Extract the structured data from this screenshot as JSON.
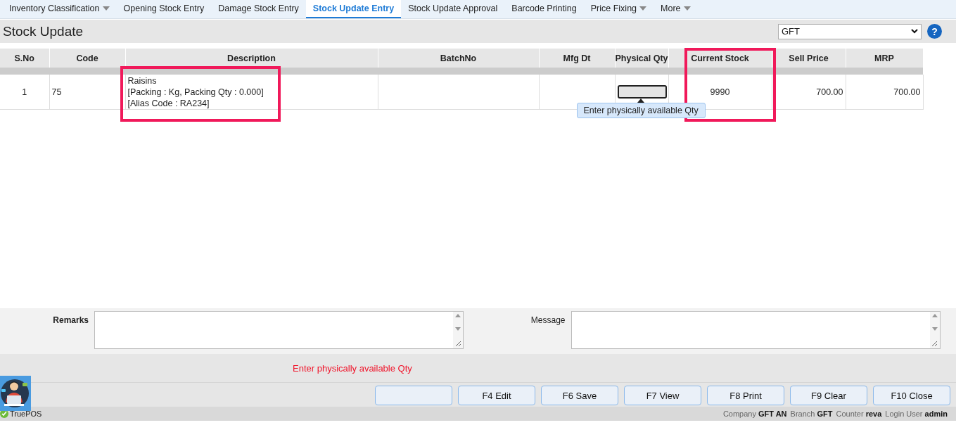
{
  "tabs": [
    {
      "label": "Inventory Classification",
      "has_menu": true,
      "selected": false
    },
    {
      "label": "Opening Stock Entry",
      "has_menu": false,
      "selected": false
    },
    {
      "label": "Damage Stock Entry",
      "has_menu": false,
      "selected": false
    },
    {
      "label": "Stock Update Entry",
      "has_menu": false,
      "selected": true
    },
    {
      "label": "Stock Update Approval",
      "has_menu": false,
      "selected": false
    },
    {
      "label": "Barcode Printing",
      "has_menu": false,
      "selected": false
    },
    {
      "label": "Price Fixing",
      "has_menu": true,
      "selected": false
    },
    {
      "label": "More",
      "has_menu": true,
      "selected": false
    }
  ],
  "page_title": "Stock Update",
  "branch_select": {
    "value": "GFT"
  },
  "help_button": "?",
  "table": {
    "columns": [
      {
        "label": "S.No",
        "highlighted": false
      },
      {
        "label": "Code",
        "highlighted": false
      },
      {
        "label": "Description",
        "highlighted": true
      },
      {
        "label": "BatchNo",
        "highlighted": false
      },
      {
        "label": "Mfg Dt",
        "highlighted": false
      },
      {
        "label": "Physical Qty",
        "highlighted": false
      },
      {
        "label": "Current Stock",
        "highlighted": true
      },
      {
        "label": "Sell Price",
        "highlighted": false
      },
      {
        "label": "MRP",
        "highlighted": false
      }
    ],
    "rows": [
      {
        "sno": "1",
        "code": "75",
        "description": [
          "Raisins",
          "[Packing : Kg, Packing Qty : 0.000]",
          "[Alias Code : RA234]"
        ],
        "batch_no": "",
        "mfg_dt": "",
        "physical_qty_tooltip": "Enter physically available Qty",
        "current_stock": "9990",
        "sell_price": "700.00",
        "mrp": "700.00"
      }
    ]
  },
  "remarks": {
    "label": "Remarks"
  },
  "message": {
    "label": "Message"
  },
  "status_message": "Enter physically available Qty",
  "buttons": [
    {
      "kind": "blank"
    },
    {
      "kind": "labeled",
      "label": "F4 Edit"
    },
    {
      "kind": "labeled",
      "label": "F6 Save"
    },
    {
      "kind": "labeled",
      "label": "F7 View"
    },
    {
      "kind": "labeled",
      "label": "F8 Print"
    },
    {
      "kind": "labeled",
      "label": "F9 Clear"
    },
    {
      "kind": "labeled",
      "label": "F10 Close"
    }
  ],
  "status_bar": {
    "app_name": "TruePOS",
    "fields": [
      {
        "label": "Company",
        "value": "GFT AN"
      },
      {
        "label": "Branch",
        "value": "GFT"
      },
      {
        "label": "Counter",
        "value": "reva"
      },
      {
        "label": "Login User",
        "value": "admin"
      }
    ]
  }
}
